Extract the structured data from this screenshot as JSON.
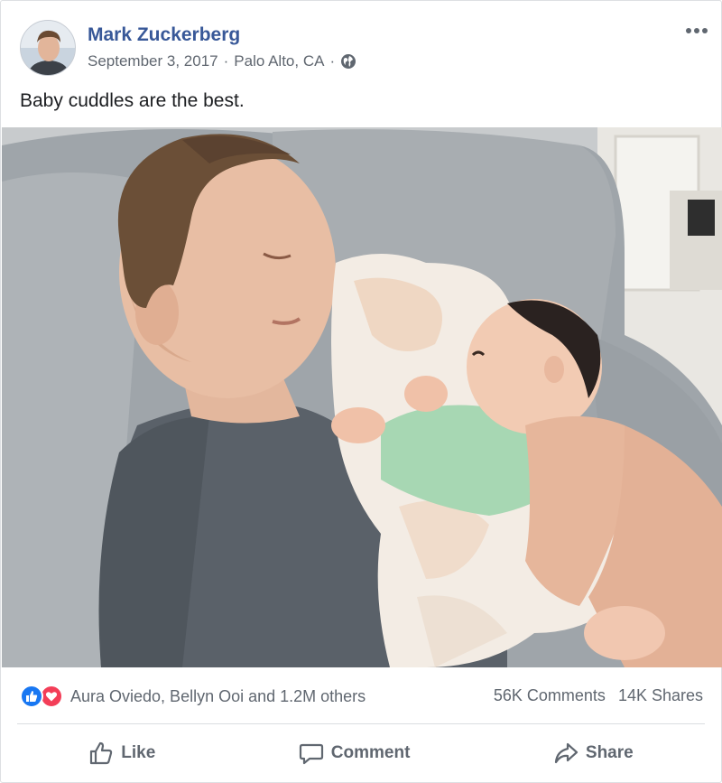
{
  "post": {
    "author": "Mark Zuckerberg",
    "date": "September 3, 2017",
    "location": "Palo Alto, CA",
    "separator": "·",
    "privacy_icon": "globe-icon",
    "caption": "Baby cuddles are the best.",
    "more_icon": "ellipsis-icon"
  },
  "reactions": {
    "icons": [
      "like-reaction-icon",
      "love-reaction-icon"
    ],
    "names": "Aura Oviedo, Bellyn Ooi and 1.2M others",
    "comments": "56K Comments",
    "shares": "14K Shares"
  },
  "actions": {
    "like": "Like",
    "comment": "Comment",
    "share": "Share"
  },
  "colors": {
    "author_link": "#385898",
    "secondary_text": "#606770",
    "like_blue": "#1877f2",
    "love_red": "#f33e58"
  }
}
